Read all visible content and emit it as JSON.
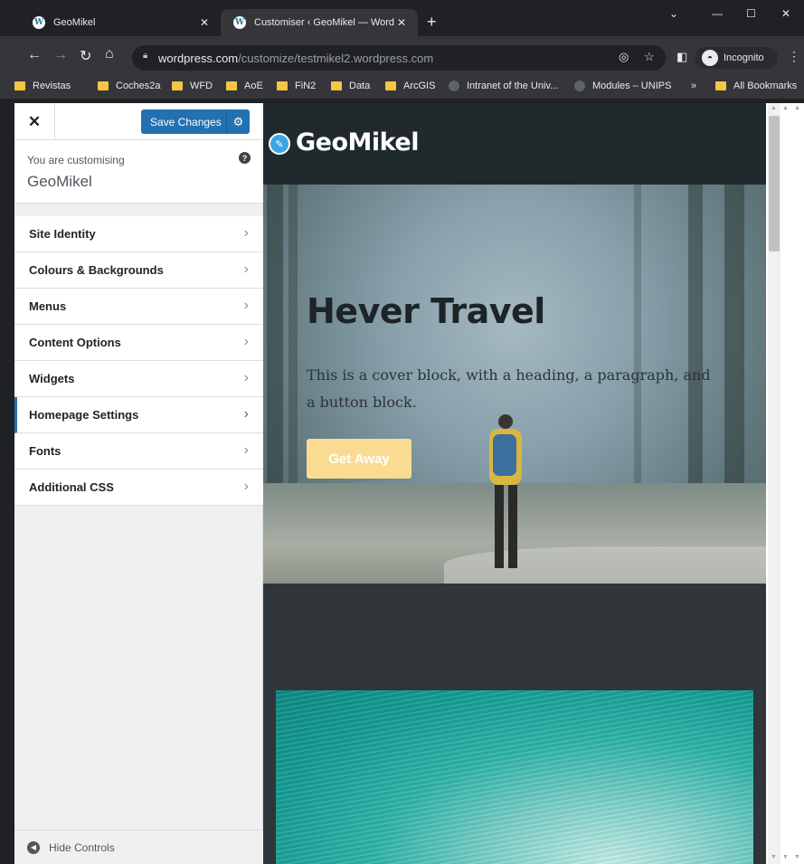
{
  "browser": {
    "tabs": [
      {
        "title": "GeoMikel"
      },
      {
        "title": "Customiser ‹ GeoMikel — Word"
      }
    ],
    "url_host": "wordpress.com",
    "url_path": "/customize/testmikel2.wordpress.com",
    "incognito_label": "Incognito",
    "bookmarks": [
      {
        "label": "Revistas",
        "icon": "folder-icon"
      },
      {
        "label": "Coches2a",
        "icon": "folder-icon"
      },
      {
        "label": "WFD",
        "icon": "folder-icon"
      },
      {
        "label": "AoE",
        "icon": "folder-icon"
      },
      {
        "label": "FiN2",
        "icon": "folder-icon"
      },
      {
        "label": "Data",
        "icon": "folder-icon"
      },
      {
        "label": "ArcGIS",
        "icon": "folder-icon"
      },
      {
        "label": "Intranet of the Univ...",
        "icon": "globe-icon"
      },
      {
        "label": "Modules – UNIPS",
        "icon": "globe-icon"
      }
    ],
    "bookmarks_more": "»",
    "all_bookmarks": "All Bookmarks",
    "colors": {
      "chrome_dark": "#202124",
      "chrome_toolbar": "#35363a"
    }
  },
  "customizer": {
    "save_label": "Save Changes",
    "customising_label": "You are customising",
    "site_name": "GeoMikel",
    "menu": [
      {
        "label": "Site Identity"
      },
      {
        "label": "Colours & Backgrounds"
      },
      {
        "label": "Menus"
      },
      {
        "label": "Content Options"
      },
      {
        "label": "Widgets"
      },
      {
        "label": "Homepage Settings"
      },
      {
        "label": "Fonts"
      },
      {
        "label": "Additional CSS"
      }
    ],
    "active_item": "Homepage Settings",
    "hide_controls": "Hide Controls",
    "colors": {
      "accent": "#2271b1"
    }
  },
  "preview": {
    "site_title": "GeoMikel",
    "cover_heading": "Hever Travel",
    "cover_paragraph": "This is a cover block, with a heading, a paragraph, and a button block.",
    "cover_button": "Get Away",
    "colors": {
      "header_bg": "#202a2c",
      "button_bg": "#f9dc92"
    }
  }
}
